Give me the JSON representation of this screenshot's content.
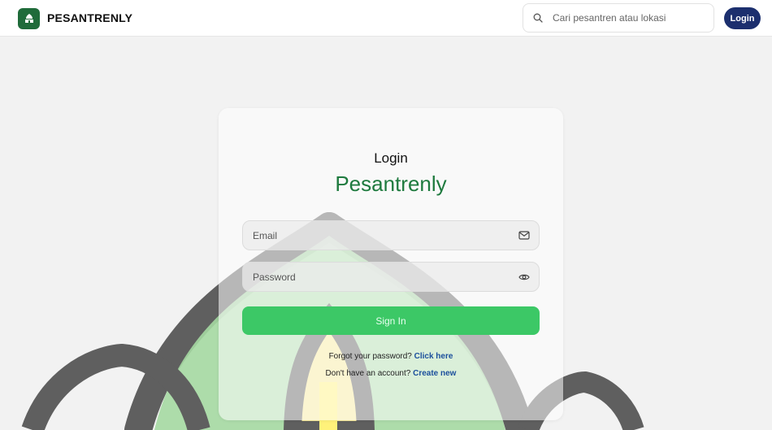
{
  "header": {
    "brand_name": "PESANTRENLY",
    "logo_icon": "mosque-logo-icon",
    "search": {
      "placeholder": "Cari pesantren atau lokasi",
      "value": "",
      "icon": "search-icon"
    },
    "login_label": "Login"
  },
  "card": {
    "title": "Login",
    "brand": "Pesantrenly",
    "email": {
      "placeholder": "Email",
      "value": "",
      "icon": "mail-icon"
    },
    "password": {
      "placeholder": "Password",
      "value": "",
      "icon": "eye-icon"
    },
    "signin_label": "Sign In",
    "forgot_text": "Forgot your password?",
    "forgot_link": "Click here",
    "create_text": "Don't have an account?",
    "create_link": "Create new"
  },
  "colors": {
    "brand_green": "#1e7a3e",
    "button_green": "#3cc866",
    "login_navy": "#1c2f6e",
    "link_blue": "#1b4f9c"
  }
}
